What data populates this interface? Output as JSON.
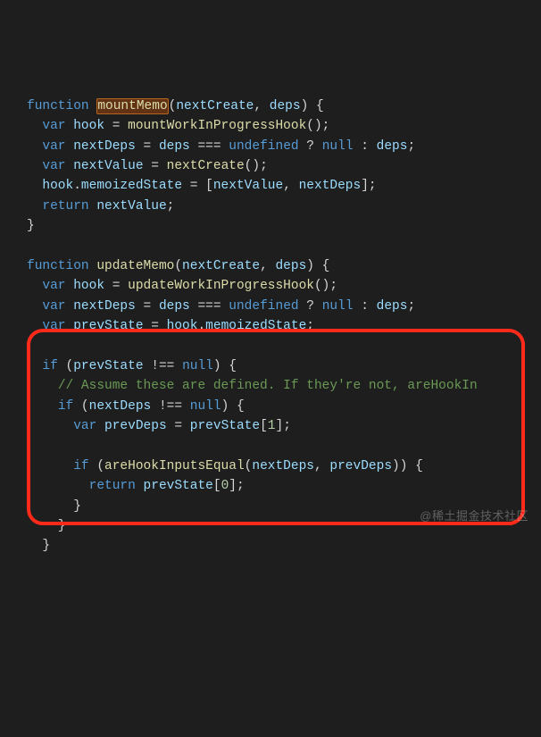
{
  "watermark": "@稀土掘金技术社区",
  "code": {
    "lines": [
      [
        {
          "t": "function",
          "c": "tok-kw"
        },
        {
          "t": " "
        },
        {
          "t": "mountMemo",
          "c": "tok-fn hl"
        },
        {
          "t": "("
        },
        {
          "t": "nextCreate",
          "c": "tok-var"
        },
        {
          "t": ", "
        },
        {
          "t": "deps",
          "c": "tok-var"
        },
        {
          "t": ") {"
        }
      ],
      [
        {
          "t": "  "
        },
        {
          "t": "var",
          "c": "tok-kw"
        },
        {
          "t": " "
        },
        {
          "t": "hook",
          "c": "tok-var"
        },
        {
          "t": " = "
        },
        {
          "t": "mountWorkInProgressHook",
          "c": "tok-fn"
        },
        {
          "t": "();"
        }
      ],
      [
        {
          "t": "  "
        },
        {
          "t": "var",
          "c": "tok-kw"
        },
        {
          "t": " "
        },
        {
          "t": "nextDeps",
          "c": "tok-var"
        },
        {
          "t": " = "
        },
        {
          "t": "deps",
          "c": "tok-var"
        },
        {
          "t": " === "
        },
        {
          "t": "undefined",
          "c": "tok-kw"
        },
        {
          "t": " ? "
        },
        {
          "t": "null",
          "c": "tok-kw"
        },
        {
          "t": " : "
        },
        {
          "t": "deps",
          "c": "tok-var"
        },
        {
          "t": ";"
        }
      ],
      [
        {
          "t": "  "
        },
        {
          "t": "var",
          "c": "tok-kw"
        },
        {
          "t": " "
        },
        {
          "t": "nextValue",
          "c": "tok-var"
        },
        {
          "t": " = "
        },
        {
          "t": "nextCreate",
          "c": "tok-fn"
        },
        {
          "t": "();"
        }
      ],
      [
        {
          "t": "  "
        },
        {
          "t": "hook",
          "c": "tok-var"
        },
        {
          "t": "."
        },
        {
          "t": "memoizedState",
          "c": "tok-prop"
        },
        {
          "t": " = ["
        },
        {
          "t": "nextValue",
          "c": "tok-var"
        },
        {
          "t": ", "
        },
        {
          "t": "nextDeps",
          "c": "tok-var"
        },
        {
          "t": "];"
        }
      ],
      [
        {
          "t": "  "
        },
        {
          "t": "return",
          "c": "tok-kw"
        },
        {
          "t": " "
        },
        {
          "t": "nextValue",
          "c": "tok-var"
        },
        {
          "t": ";"
        }
      ],
      [
        {
          "t": "}"
        }
      ],
      [
        {
          "t": ""
        }
      ],
      [
        {
          "t": "function",
          "c": "tok-kw"
        },
        {
          "t": " "
        },
        {
          "t": "updateMemo",
          "c": "tok-fn"
        },
        {
          "t": "("
        },
        {
          "t": "nextCreate",
          "c": "tok-var"
        },
        {
          "t": ", "
        },
        {
          "t": "deps",
          "c": "tok-var"
        },
        {
          "t": ") {"
        }
      ],
      [
        {
          "t": "  "
        },
        {
          "t": "var",
          "c": "tok-kw"
        },
        {
          "t": " "
        },
        {
          "t": "hook",
          "c": "tok-var"
        },
        {
          "t": " = "
        },
        {
          "t": "updateWorkInProgressHook",
          "c": "tok-fn"
        },
        {
          "t": "();"
        }
      ],
      [
        {
          "t": "  "
        },
        {
          "t": "var",
          "c": "tok-kw"
        },
        {
          "t": " "
        },
        {
          "t": "nextDeps",
          "c": "tok-var"
        },
        {
          "t": " = "
        },
        {
          "t": "deps",
          "c": "tok-var"
        },
        {
          "t": " === "
        },
        {
          "t": "undefined",
          "c": "tok-kw"
        },
        {
          "t": " ? "
        },
        {
          "t": "null",
          "c": "tok-kw"
        },
        {
          "t": " : "
        },
        {
          "t": "deps",
          "c": "tok-var"
        },
        {
          "t": ";"
        }
      ],
      [
        {
          "t": "  "
        },
        {
          "t": "var",
          "c": "tok-kw"
        },
        {
          "t": " "
        },
        {
          "t": "prevState",
          "c": "tok-var"
        },
        {
          "t": " = "
        },
        {
          "t": "hook",
          "c": "tok-var"
        },
        {
          "t": "."
        },
        {
          "t": "memoizedState",
          "c": "tok-prop"
        },
        {
          "t": ";"
        }
      ],
      [
        {
          "t": ""
        }
      ],
      [
        {
          "t": "  "
        },
        {
          "t": "if",
          "c": "tok-kw"
        },
        {
          "t": " ("
        },
        {
          "t": "prevState",
          "c": "tok-var"
        },
        {
          "t": " !== "
        },
        {
          "t": "null",
          "c": "tok-kw"
        },
        {
          "t": ") {"
        }
      ],
      [
        {
          "t": "    "
        },
        {
          "t": "// Assume these are defined. If they're not, areHookIn",
          "c": "tok-cmt"
        }
      ],
      [
        {
          "t": "    "
        },
        {
          "t": "if",
          "c": "tok-kw"
        },
        {
          "t": " ("
        },
        {
          "t": "nextDeps",
          "c": "tok-var"
        },
        {
          "t": " !== "
        },
        {
          "t": "null",
          "c": "tok-kw"
        },
        {
          "t": ") {"
        }
      ],
      [
        {
          "t": "      "
        },
        {
          "t": "var",
          "c": "tok-kw"
        },
        {
          "t": " "
        },
        {
          "t": "prevDeps",
          "c": "tok-var"
        },
        {
          "t": " = "
        },
        {
          "t": "prevState",
          "c": "tok-var"
        },
        {
          "t": "["
        },
        {
          "t": "1",
          "c": "tok-num"
        },
        {
          "t": "];"
        }
      ],
      [
        {
          "t": ""
        }
      ],
      [
        {
          "t": "      "
        },
        {
          "t": "if",
          "c": "tok-kw"
        },
        {
          "t": " ("
        },
        {
          "t": "areHookInputsEqual",
          "c": "tok-fn"
        },
        {
          "t": "("
        },
        {
          "t": "nextDeps",
          "c": "tok-var"
        },
        {
          "t": ", "
        },
        {
          "t": "prevDeps",
          "c": "tok-var"
        },
        {
          "t": ")) {"
        }
      ],
      [
        {
          "t": "        "
        },
        {
          "t": "return",
          "c": "tok-kw"
        },
        {
          "t": " "
        },
        {
          "t": "prevState",
          "c": "tok-var"
        },
        {
          "t": "["
        },
        {
          "t": "0",
          "c": "tok-num"
        },
        {
          "t": "];"
        }
      ],
      [
        {
          "t": "      }"
        }
      ],
      [
        {
          "t": "    }"
        }
      ],
      [
        {
          "t": "  }"
        }
      ]
    ]
  }
}
